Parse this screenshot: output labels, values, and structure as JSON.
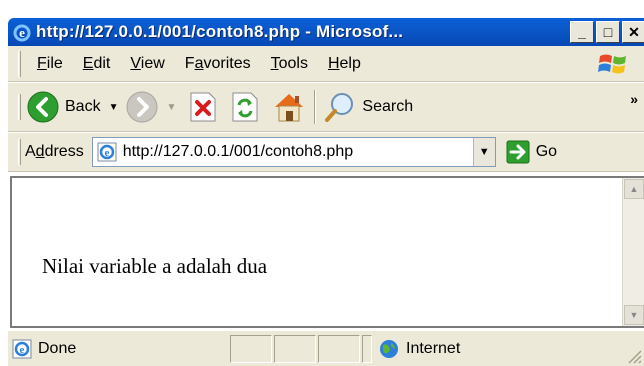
{
  "window": {
    "title": "http://127.0.0.1/001/contoh8.php - Microsof...",
    "buttons": {
      "minimize": "_",
      "maximize": "□",
      "close": "✕"
    }
  },
  "menu": {
    "items": [
      {
        "pre": "",
        "key": "F",
        "post": "ile"
      },
      {
        "pre": "",
        "key": "E",
        "post": "dit"
      },
      {
        "pre": "",
        "key": "V",
        "post": "iew"
      },
      {
        "pre": "F",
        "key": "a",
        "post": "vorites"
      },
      {
        "pre": "",
        "key": "T",
        "post": "ools"
      },
      {
        "pre": "",
        "key": "H",
        "post": "elp"
      }
    ]
  },
  "toolbar": {
    "back_label": "Back",
    "search_label": "Search",
    "more": "»"
  },
  "address": {
    "label_pre": "A",
    "label_key": "d",
    "label_post": "dress",
    "url": "http://127.0.0.1/001/contoh8.php",
    "go_label": "Go"
  },
  "page": {
    "text": "Nilai variable a adalah dua"
  },
  "status": {
    "text": "Done",
    "zone": "Internet"
  },
  "icons": {
    "window": "ie-icon",
    "back": "back-arrow-icon",
    "forward": "forward-arrow-icon",
    "stop": "stop-icon",
    "refresh": "refresh-icon",
    "home": "home-icon",
    "search": "search-icon",
    "go": "go-arrow-icon",
    "zone": "internet-globe-icon"
  },
  "colors": {
    "titlebar": "#0a5fd8",
    "chrome": "#ece9d8",
    "back_green": "#2e9e2e",
    "stop_red": "#d81b1b"
  }
}
